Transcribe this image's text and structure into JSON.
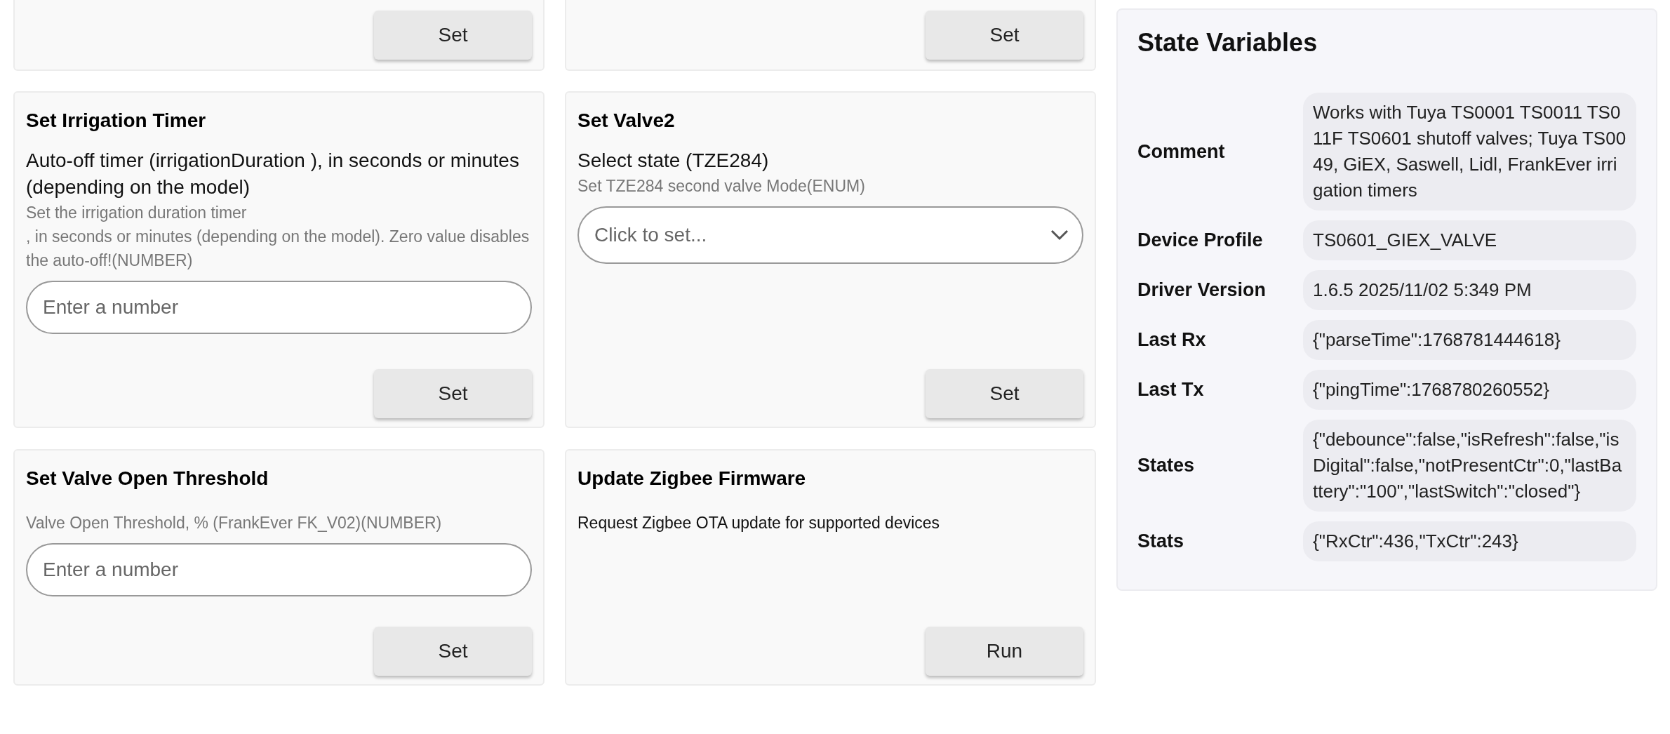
{
  "cards_top": [
    {
      "button": "Set"
    },
    {
      "button": "Set"
    }
  ],
  "cards": [
    {
      "kind": "number",
      "title": "Set Irrigation Timer",
      "label": "Auto-off timer (irrigationDuration ), in seconds or minutes (depending on the model)",
      "description": "Set the irrigation duration timer\n, in seconds or minutes (depending on the model). Zero value disables the auto-off!(NUMBER)",
      "placeholder": "Enter a number",
      "button": "Set"
    },
    {
      "kind": "select",
      "title": "Set Valve2",
      "label": "Select state (TZE284)",
      "description": "Set TZE284 second valve Mode(ENUM)",
      "placeholder": "Click to set...",
      "button": "Set"
    },
    {
      "kind": "number",
      "title": "Set Valve Open Threshold",
      "description": "Valve Open Threshold, % (FrankEver FK_V02)(NUMBER)",
      "placeholder": "Enter a number",
      "button": "Set"
    },
    {
      "kind": "command",
      "title": "Update Zigbee Firmware",
      "description": "Request Zigbee OTA update for supported devices",
      "button": "Run"
    }
  ],
  "state_variables": {
    "title": "State Variables",
    "rows": [
      {
        "name": "Comment",
        "value": "Works with Tuya TS0001 TS0011 TS011F TS0601 shutoff valves; Tuya TS0049, GiEX, Saswell, Lidl, FrankEver irrigation timers"
      },
      {
        "name": "Device Profile",
        "value": "TS0601_GIEX_VALVE"
      },
      {
        "name": "Driver Version",
        "value": "1.6.5 2025/11/02 5:349 PM"
      },
      {
        "name": "Last Rx",
        "value": "{\"parseTime\":1768781444618}"
      },
      {
        "name": "Last Tx",
        "value": "{\"pingTime\":1768780260552}"
      },
      {
        "name": "States",
        "value": "{\"debounce\":false,\"isRefresh\":false,\"isDigital\":false,\"notPresentCtr\":0,\"lastBattery\":\"100\",\"lastSwitch\":\"closed\"}"
      },
      {
        "name": "Stats",
        "value": "{\"RxCtr\":436,\"TxCtr\":243}"
      }
    ]
  }
}
